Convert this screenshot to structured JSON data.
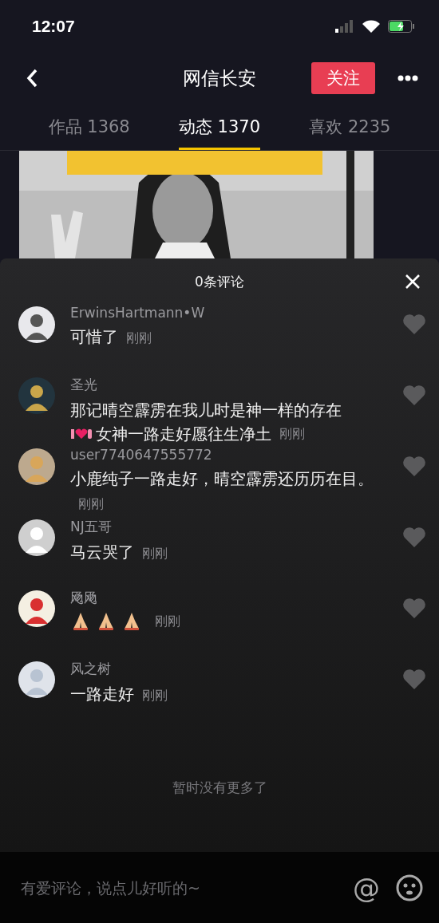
{
  "status_bar": {
    "time": "12:07"
  },
  "header": {
    "title": "网信长安",
    "follow_button": "关注"
  },
  "tabs": [
    {
      "label": "作品 1368",
      "selected": false
    },
    {
      "label": "动态 1370",
      "selected": true
    },
    {
      "label": "喜欢 2235",
      "selected": false
    }
  ],
  "comments_sheet": {
    "title": "0条评论",
    "comments": [
      {
        "kind": "text",
        "author": "ErwinsHartmann•W",
        "text": "可惜了",
        "time": "刚刚",
        "liked": false
      },
      {
        "kind": "sticker",
        "author": "圣光",
        "text": "那记晴空霹雳在我儿时是神一样的存在",
        "text_2": "女神一路走好愿往生净土",
        "time": "刚刚",
        "liked": false
      },
      {
        "kind": "text",
        "author": "user7740647555772",
        "text": "小鹿纯子一路走好，晴空霹雳还历历在目。",
        "time": "刚刚",
        "liked": false
      },
      {
        "kind": "text",
        "author": "NJ五哥",
        "text": "马云哭了",
        "time": "刚刚",
        "liked": false
      },
      {
        "kind": "emoji",
        "author": "飏飏",
        "time": "刚刚",
        "liked": false
      },
      {
        "kind": "text",
        "author": "风之树",
        "text": "一路走好",
        "time": "刚刚",
        "liked": false
      }
    ],
    "footer": "暂时没有更多了"
  },
  "input_bar": {
    "placeholder": "有爱评论，说点儿好听的~",
    "mention": "@"
  }
}
